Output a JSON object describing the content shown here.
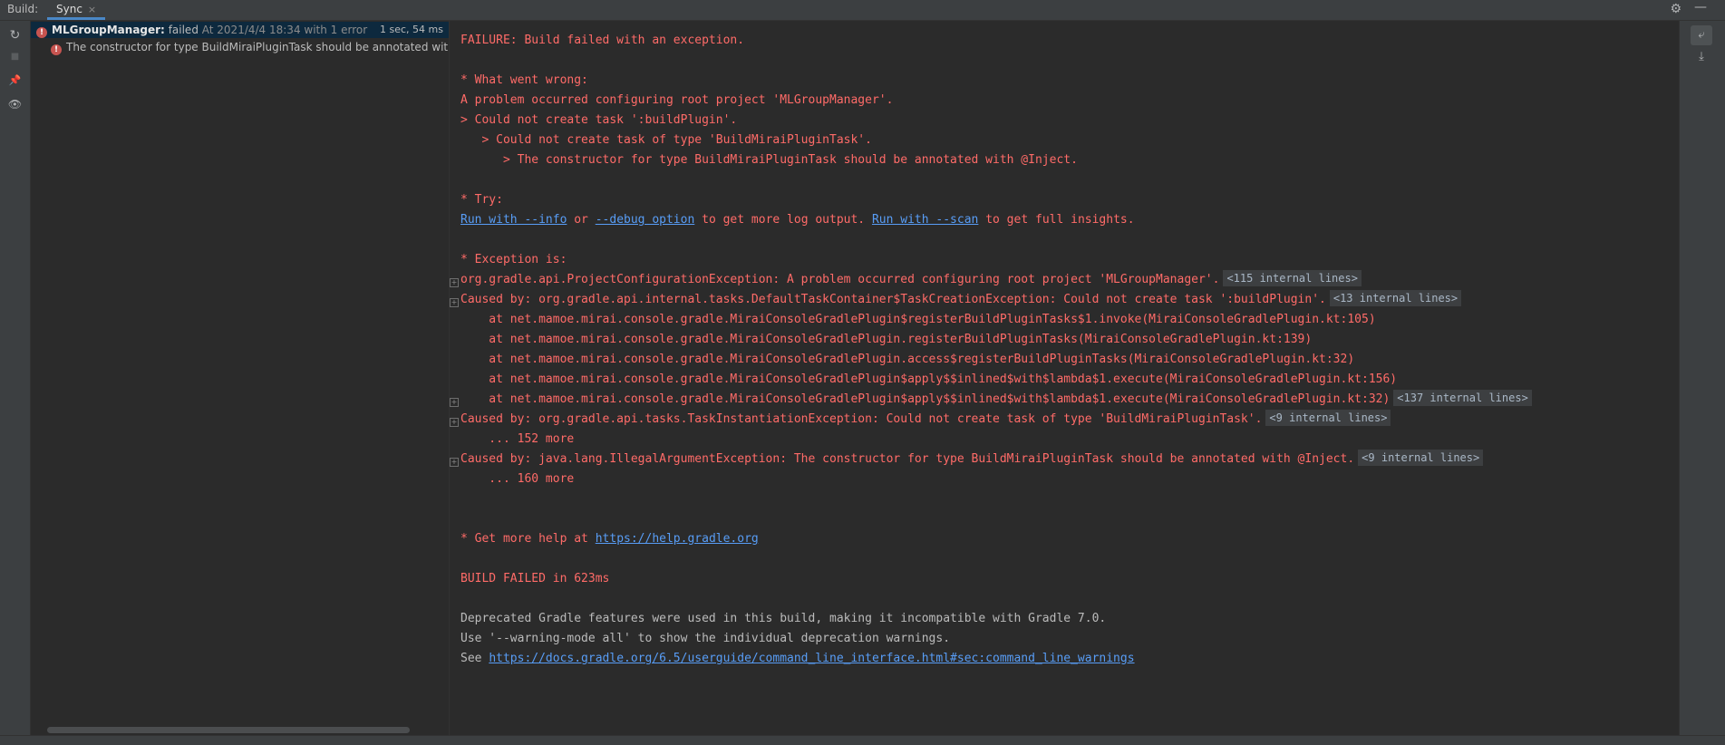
{
  "window": {
    "title": "Build:",
    "tab_label": "Sync",
    "tab_close": "×"
  },
  "tree": {
    "root": {
      "name": "MLGroupManager:",
      "status": "failed",
      "detail": "At 2021/4/4 18:34 with 1 error",
      "duration": "1 sec, 54 ms"
    },
    "child": {
      "text": "The constructor for type BuildMiraiPluginTask should be annotated with"
    }
  },
  "console": {
    "l1": "FAILURE: Build failed with an exception.",
    "l2": "* What went wrong:",
    "l3": "A problem occurred configuring root project 'MLGroupManager'.",
    "l4": "> Could not create task ':buildPlugin'.",
    "l5": "   > Could not create task of type 'BuildMiraiPluginTask'.",
    "l6": "      > The constructor for type BuildMiraiPluginTask should be annotated with @Inject.",
    "l7": "* Try:",
    "try_link1": "Run with --info",
    "try_or": " or ",
    "try_link2": "--debug option",
    "try_mid": " to get more log output. ",
    "try_link3": "Run with --scan",
    "try_end": " to get full insights.",
    "l8": "* Exception is:",
    "e1": "org.gradle.api.ProjectConfigurationException: A problem occurred configuring root project 'MLGroupManager'.",
    "e1_internal": "<115 internal lines>",
    "e2": "Caused by: org.gradle.api.internal.tasks.DefaultTaskContainer$TaskCreationException: Could not create task ':buildPlugin'.",
    "e2_internal": "<13 internal lines>",
    "s1": "    at net.mamoe.mirai.console.gradle.MiraiConsoleGradlePlugin$registerBuildPluginTasks$1.invoke(MiraiConsoleGradlePlugin.kt:105)",
    "s2": "    at net.mamoe.mirai.console.gradle.MiraiConsoleGradlePlugin.registerBuildPluginTasks(MiraiConsoleGradlePlugin.kt:139)",
    "s3": "    at net.mamoe.mirai.console.gradle.MiraiConsoleGradlePlugin.access$registerBuildPluginTasks(MiraiConsoleGradlePlugin.kt:32)",
    "s4": "    at net.mamoe.mirai.console.gradle.MiraiConsoleGradlePlugin$apply$$inlined$with$lambda$1.execute(MiraiConsoleGradlePlugin.kt:156)",
    "s5": "    at net.mamoe.mirai.console.gradle.MiraiConsoleGradlePlugin$apply$$inlined$with$lambda$1.execute(MiraiConsoleGradlePlugin.kt:32)",
    "s5_internal": "<137 internal lines>",
    "e3": "Caused by: org.gradle.api.tasks.TaskInstantiationException: Could not create task of type 'BuildMiraiPluginTask'.",
    "e3_internal": "<9 internal lines>",
    "m1": "    ... 152 more",
    "e4": "Caused by: java.lang.IllegalArgumentException: The constructor for type BuildMiraiPluginTask should be annotated with @Inject.",
    "e4_internal": "<9 internal lines>",
    "m2": "    ... 160 more",
    "help_prefix": "* Get more help at ",
    "help_link": "https://help.gradle.org",
    "failed": "BUILD FAILED in 623ms",
    "d1": "Deprecated Gradle features were used in this build, making it incompatible with Gradle 7.0.",
    "d2": "Use '--warning-mode all' to show the individual deprecation warnings.",
    "d3_prefix": "See ",
    "d3_link": "https://docs.gradle.org/6.5/userguide/command_line_interface.html#sec:command_line_warnings"
  },
  "icons": {
    "sync": "↻",
    "stop": "■",
    "pin": "📌",
    "eye": "👁",
    "gear": "⚙",
    "minimize": "—",
    "wrap": "⤶",
    "scroll_end": "⤓",
    "error": "!",
    "fold": "+"
  },
  "colors": {
    "error_text": "#ff6b68",
    "link": "#589df6",
    "selection": "#0d293e",
    "tab_underline": "#4a88c7"
  }
}
